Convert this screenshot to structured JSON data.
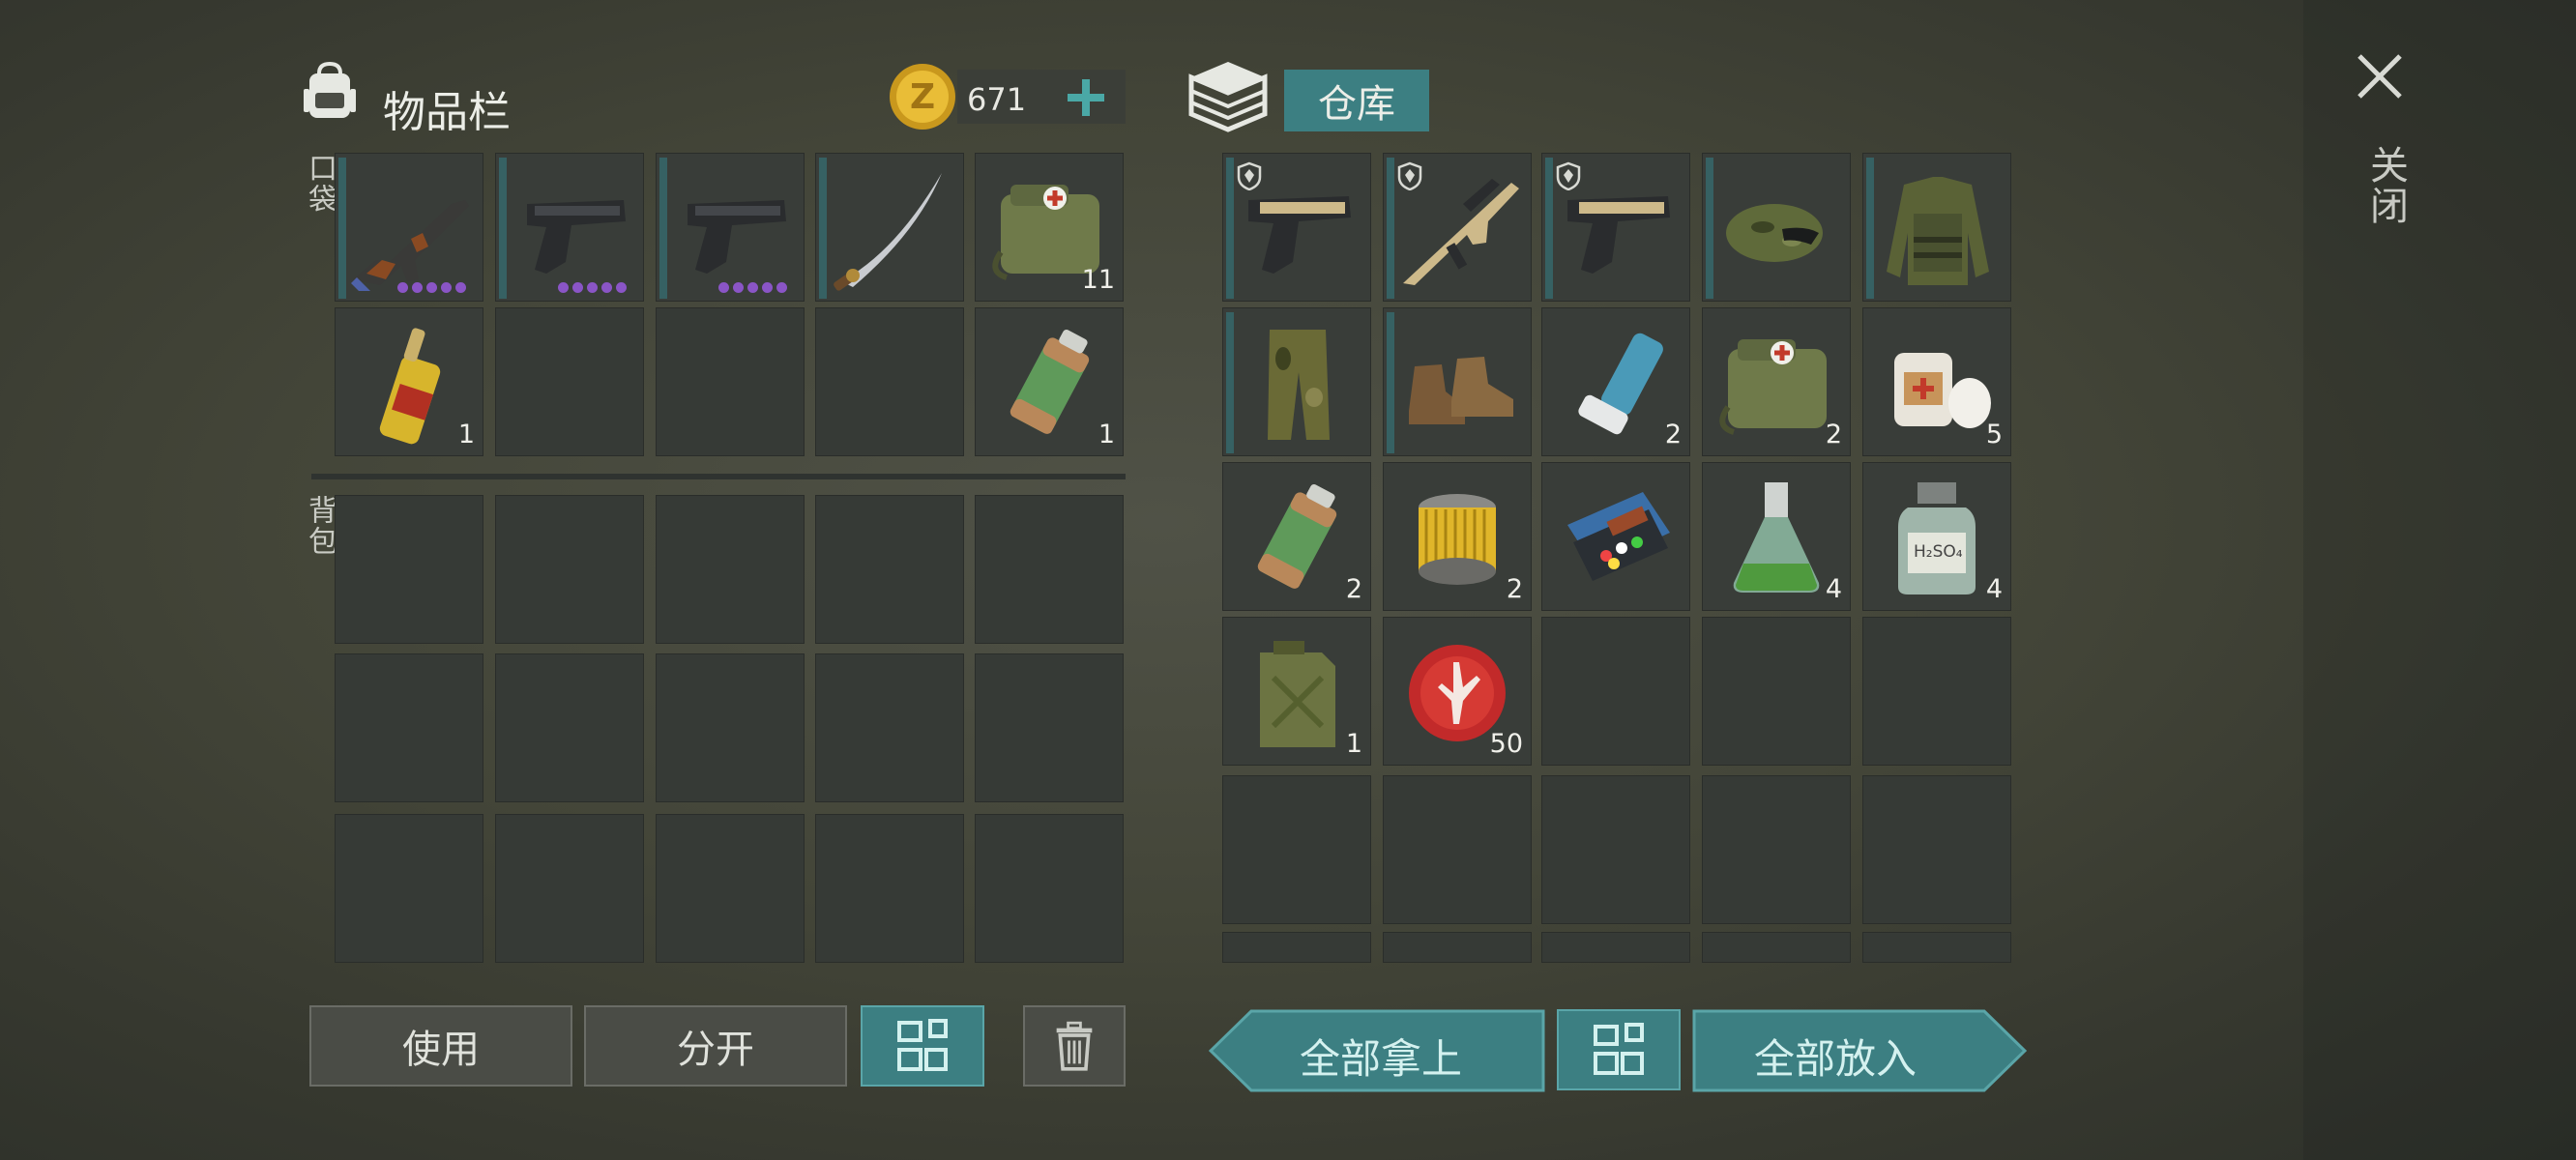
{
  "inventory": {
    "title": "物品栏",
    "coins": "671",
    "pocket_label": "口袋",
    "backpack_label": "背包",
    "pocket_slots": [
      {
        "icon": "ak-rifle-icon",
        "count": "",
        "bar": "full",
        "dots": true
      },
      {
        "icon": "pistol-icon",
        "count": "",
        "bar": "full",
        "dots": true
      },
      {
        "icon": "pistol-icon",
        "count": "",
        "bar": "full",
        "dots": true
      },
      {
        "icon": "katana-icon",
        "count": "",
        "bar": "full",
        "dots": false
      },
      {
        "icon": "medkit-bag-icon",
        "count": "11",
        "bar": "none",
        "dots": false
      },
      {
        "icon": "ampoule-icon",
        "count": "1",
        "bar": "none",
        "dots": false
      },
      {
        "icon": "",
        "count": "",
        "bar": "none",
        "dots": false
      },
      {
        "icon": "",
        "count": "",
        "bar": "none",
        "dots": false
      },
      {
        "icon": "",
        "count": "",
        "bar": "none",
        "dots": false
      },
      {
        "icon": "canister-icon",
        "count": "1",
        "bar": "none",
        "dots": false
      }
    ],
    "buttons": {
      "use": "使用",
      "split": "分开"
    }
  },
  "storage": {
    "title": "仓库",
    "slots": [
      {
        "icon": "tan-pistol-icon",
        "count": "",
        "bar": "full",
        "locked": true
      },
      {
        "icon": "tan-rifle-icon",
        "count": "",
        "bar": "full",
        "locked": true
      },
      {
        "icon": "tan-pistol-icon",
        "count": "",
        "bar": "full",
        "locked": true
      },
      {
        "icon": "camo-cap-icon",
        "count": "",
        "bar": "full",
        "locked": false
      },
      {
        "icon": "camo-jacket-icon",
        "count": "",
        "bar": "full",
        "locked": false
      },
      {
        "icon": "camo-pants-icon",
        "count": "",
        "bar": "full",
        "locked": false
      },
      {
        "icon": "boots-icon",
        "count": "",
        "bar": "full",
        "locked": false
      },
      {
        "icon": "inhaler-icon",
        "count": "2",
        "bar": "none",
        "locked": false
      },
      {
        "icon": "medkit-bag-icon",
        "count": "2",
        "bar": "none",
        "locked": false
      },
      {
        "icon": "bandage-icon",
        "count": "5",
        "bar": "none",
        "locked": false
      },
      {
        "icon": "canister-icon",
        "count": "2",
        "bar": "none",
        "locked": false
      },
      {
        "icon": "filter-icon",
        "count": "2",
        "bar": "none",
        "locked": false
      },
      {
        "icon": "pill-case-icon",
        "count": "",
        "bar": "none",
        "locked": false
      },
      {
        "icon": "flask-icon",
        "count": "4",
        "bar": "none",
        "locked": false
      },
      {
        "icon": "bottle-h2so4-icon",
        "count": "4",
        "bar": "none",
        "locked": false
      },
      {
        "icon": "jerrycan-icon",
        "count": "1",
        "bar": "none",
        "locked": false
      },
      {
        "icon": "bottle-cap-icon",
        "count": "50",
        "bar": "none",
        "locked": false
      }
    ],
    "bottle_label": "H₂SO₄",
    "buttons": {
      "take_all": "全部拿上",
      "put_all": "全部放入"
    }
  },
  "close_label": "关闭",
  "colors": {
    "accent": "#3c7f82",
    "bar": "#366163",
    "dot": "#8a55c6"
  }
}
